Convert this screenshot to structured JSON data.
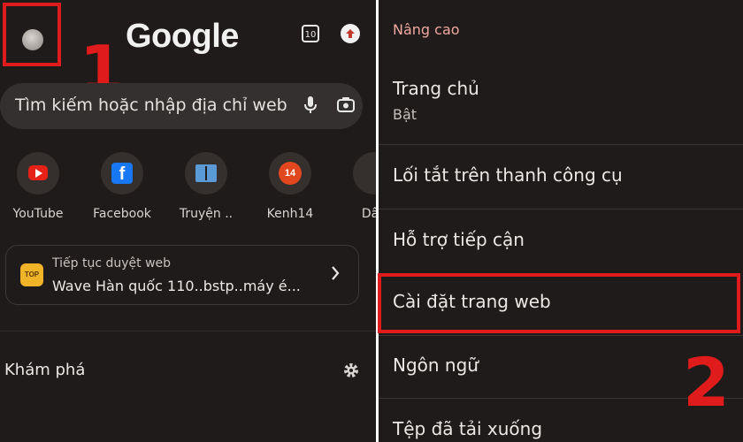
{
  "left": {
    "logo": "Google",
    "tabs_count": "10",
    "search": {
      "placeholder": "Tìm kiếm hoặc nhập địa chỉ web"
    },
    "shortcuts": [
      {
        "label": "YouTube",
        "icon": "youtube-icon"
      },
      {
        "label": "Facebook",
        "icon": "facebook-icon"
      },
      {
        "label": "Truyện ..",
        "icon": "book-icon"
      },
      {
        "label": "Kenh14",
        "icon": "kenh14-icon"
      },
      {
        "label": "Dân",
        "icon": "partial-site-icon"
      }
    ],
    "continue_card": {
      "title": "Tiếp tục duyệt web",
      "subtitle": "Wave Hàn quốc 110..bstp..máy é...",
      "icon_text": "TOP"
    },
    "discover_label": "Khám phá"
  },
  "right": {
    "section_title": "Nâng cao",
    "items": [
      {
        "title": "Trang chủ",
        "subtitle": "Bật"
      },
      {
        "title": "Lối tắt trên thanh công cụ"
      },
      {
        "title": "Hỗ trợ tiếp cận"
      },
      {
        "title": "Cài đặt trang web"
      },
      {
        "title": "Ngôn ngữ"
      },
      {
        "title": "Tệp đã tải xuống"
      }
    ]
  },
  "annotations": {
    "step1": "1",
    "step2": "2"
  },
  "colors": {
    "background": "#1f1b1a",
    "highlight": "#e01b1b",
    "section_title": "#f0a8a0"
  }
}
